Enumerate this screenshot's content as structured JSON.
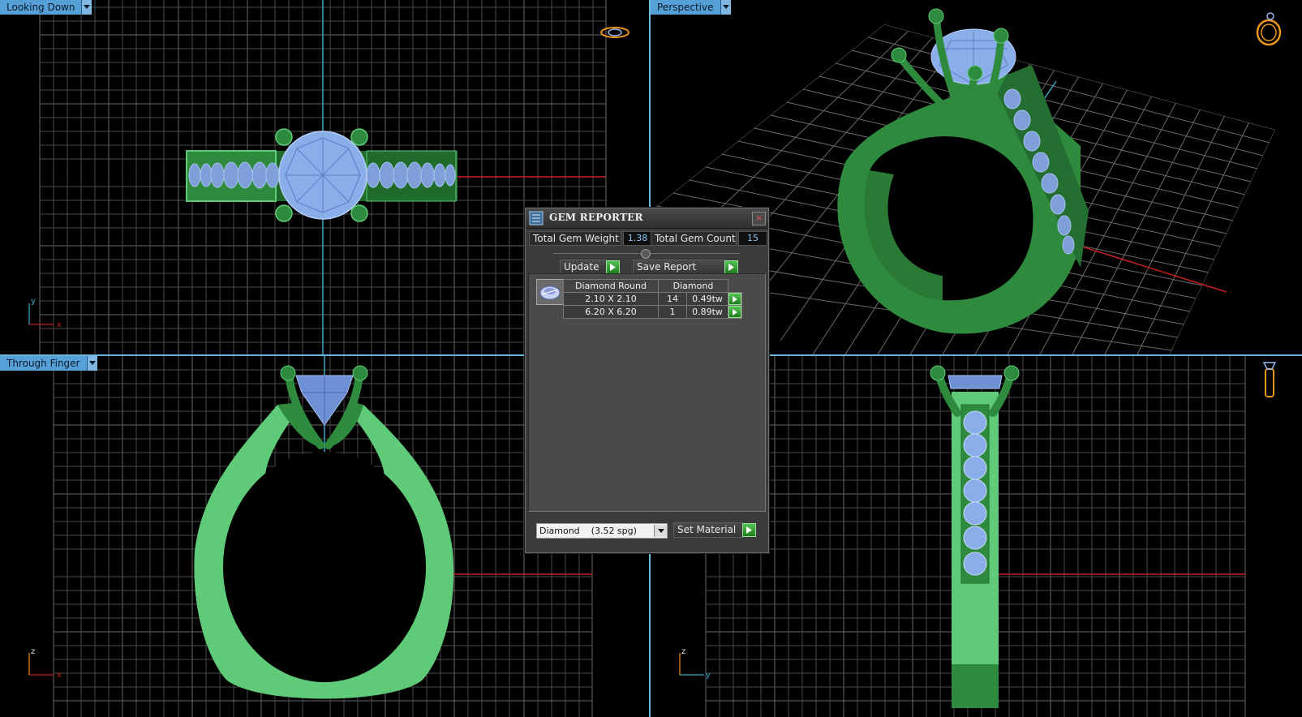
{
  "viewports": {
    "top_left": {
      "label": "Looking Down",
      "axes": [
        "y",
        "x"
      ]
    },
    "top_right": {
      "label": "Perspective"
    },
    "bottom_left": {
      "label": "Through Finger",
      "axes": [
        "z",
        "x"
      ]
    },
    "bottom_right": {
      "axes": [
        "z",
        "y"
      ]
    }
  },
  "gem_reporter": {
    "title": "GEM REPORTER",
    "close": "×",
    "total_weight_label": "Total Gem Weight",
    "total_weight_value": "1.38",
    "total_count_label": "Total Gem Count",
    "total_count_value": "15",
    "update_label": "Update",
    "save_report_label": "Save Report",
    "table": {
      "headers": [
        "Diamond Round",
        "Diamond"
      ],
      "rows": [
        {
          "size": "2.10 X 2.10",
          "count": "14",
          "weight": "0.49tw"
        },
        {
          "size": "6.20 X 6.20",
          "count": "1",
          "weight": "0.89tw"
        }
      ]
    },
    "material_select": "Diamond    (3.52 spg)",
    "set_material_label": "Set Material"
  },
  "colors": {
    "accent": "#56a0d8",
    "ring_green": "#2e8b3e",
    "ring_light_green": "#5fcb78",
    "gem_blue": "#8aaeea",
    "grid": "#8a8a8a",
    "axis_red": "#c82020",
    "axis_cyan": "#3aa6c8",
    "nav_icon": "#e8961c"
  }
}
